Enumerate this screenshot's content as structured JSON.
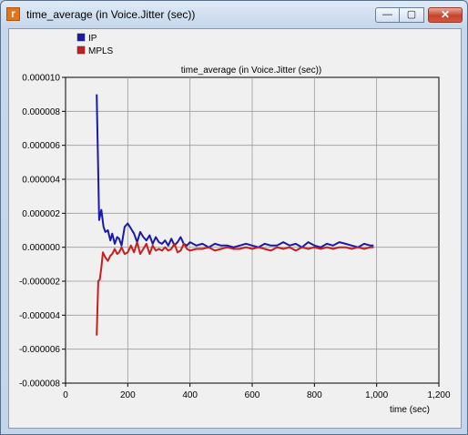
{
  "window": {
    "title": "time_average (in Voice.Jitter (sec))",
    "app_icon_glyph": "r",
    "buttons": {
      "minimize": "—",
      "maximize": "▢",
      "close": "✕"
    }
  },
  "chart_data": {
    "type": "line",
    "title": "time_average (in Voice.Jitter (sec))",
    "xlabel": "time (sec)",
    "ylabel": "",
    "xlim": [
      0,
      1200
    ],
    "ylim": [
      -8e-06,
      1e-05
    ],
    "x_ticks": [
      "0",
      "200",
      "400",
      "600",
      "800",
      "1,000",
      "1,200"
    ],
    "y_ticks": [
      "-0.000008",
      "-0.000006",
      "-0.000004",
      "-0.000002",
      "0.000000",
      "0.000002",
      "0.000004",
      "0.000006",
      "0.000008",
      "0.000010"
    ],
    "grid": true,
    "legend": "top-left",
    "series": [
      {
        "name": "IP",
        "color": "#1a1aa8",
        "x": [
          100,
          108,
          115,
          122,
          128,
          136,
          144,
          150,
          158,
          166,
          172,
          180,
          190,
          200,
          210,
          220,
          230,
          240,
          250,
          260,
          270,
          280,
          290,
          300,
          310,
          320,
          330,
          340,
          350,
          360,
          370,
          380,
          390,
          400,
          420,
          440,
          460,
          480,
          500,
          520,
          540,
          560,
          580,
          600,
          620,
          640,
          660,
          680,
          700,
          720,
          740,
          760,
          780,
          800,
          820,
          840,
          860,
          880,
          900,
          920,
          940,
          960,
          980,
          990
        ],
        "values": [
          9e-06,
          1.6e-06,
          2.2e-06,
          1.2e-06,
          9e-07,
          1e-06,
          4e-07,
          8e-07,
          2e-07,
          6e-07,
          5e-07,
          1e-07,
          1.2e-06,
          1.4e-06,
          1.1e-06,
          8e-07,
          3e-07,
          9e-07,
          6e-07,
          4e-07,
          7e-07,
          2e-07,
          6e-07,
          3e-07,
          2e-07,
          4e-07,
          1e-07,
          5e-07,
          1e-07,
          3e-07,
          6e-07,
          2e-07,
          1e-07,
          3e-07,
          1e-07,
          2e-07,
          0.0,
          2e-07,
          1e-07,
          1e-07,
          0.0,
          1e-07,
          2e-07,
          1e-07,
          0.0,
          2e-07,
          1e-07,
          1e-07,
          3e-07,
          1e-07,
          2e-07,
          0.0,
          3e-07,
          1e-07,
          0.0,
          2e-07,
          1e-07,
          3e-07,
          2e-07,
          1e-07,
          0.0,
          2e-07,
          1e-07,
          1e-07
        ]
      },
      {
        "name": "MPLS",
        "color": "#c81e1e",
        "x": [
          100,
          105,
          110,
          115,
          120,
          128,
          136,
          144,
          150,
          158,
          166,
          172,
          180,
          190,
          200,
          210,
          220,
          230,
          240,
          250,
          260,
          270,
          280,
          290,
          300,
          310,
          320,
          330,
          340,
          350,
          360,
          370,
          380,
          390,
          400,
          420,
          440,
          460,
          480,
          500,
          520,
          540,
          560,
          580,
          600,
          620,
          640,
          660,
          680,
          700,
          720,
          740,
          760,
          780,
          800,
          820,
          840,
          860,
          880,
          900,
          920,
          940,
          960,
          980,
          990
        ],
        "values": [
          -5.2e-06,
          -2e-06,
          -1.9e-06,
          -1.2e-06,
          -3e-07,
          -6e-07,
          -8e-07,
          -5e-07,
          -4e-07,
          -1e-07,
          -4e-07,
          -3e-07,
          0.0,
          -4e-07,
          -3e-07,
          1e-07,
          -3e-07,
          3e-07,
          -4e-07,
          -1e-07,
          2e-07,
          -4e-07,
          1e-07,
          -2e-07,
          -1e-07,
          -2e-07,
          0.0,
          -2e-07,
          -1e-07,
          2e-07,
          -3e-07,
          -2e-07,
          2e-07,
          -1e-07,
          -2e-07,
          -1e-07,
          -1e-07,
          0.0,
          -2e-07,
          -1e-07,
          0.0,
          -1e-07,
          -1e-07,
          0.0,
          -1e-07,
          0.0,
          -1e-07,
          -2e-07,
          0.0,
          -1e-07,
          0.0,
          -2e-07,
          0.0,
          -1e-07,
          0.0,
          -1e-07,
          0.0,
          -1e-07,
          0.0,
          0.0,
          -1e-07,
          0.0,
          -1e-07,
          0.0,
          0.0
        ]
      }
    ]
  }
}
